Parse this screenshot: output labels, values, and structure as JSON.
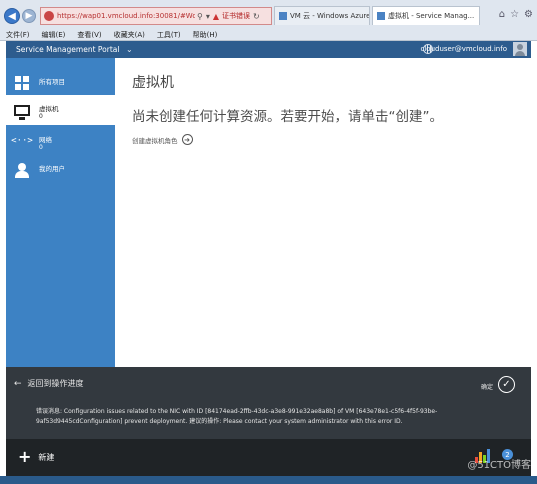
{
  "browser": {
    "url": "https://wap01.vmcloud.info:30081/#Workspace",
    "cert_error": "证书错误",
    "tabs": [
      {
        "label": "VM 云 - Windows Azure P...",
        "active": false
      },
      {
        "label": "虚拟机 - Service Manag...",
        "active": true
      }
    ],
    "menu": [
      "文件(F)",
      "编辑(E)",
      "查看(V)",
      "收藏夹(A)",
      "工具(T)",
      "帮助(H)"
    ]
  },
  "header": {
    "title": "Service Management Portal",
    "user": "clouduser@vmcloud.info"
  },
  "sidebar": {
    "items": [
      {
        "label": "所有项目",
        "count": "",
        "icon": "grid-icon"
      },
      {
        "label": "虚拟机",
        "count": "0",
        "icon": "monitor-icon",
        "selected": true
      },
      {
        "label": "网络",
        "count": "0",
        "icon": "network-icon"
      },
      {
        "label": "我的用户",
        "count": "",
        "icon": "user-icon"
      }
    ]
  },
  "main": {
    "title": "虚拟机",
    "empty_message": "尚未创建任何计算资源。若要开始，请单击“创建”。",
    "create_link": "创建虚拟机角色"
  },
  "notification": {
    "back_label": "返回到操作进度",
    "ok_label": "确定",
    "error_text": "错误消息: Configuration issues related to the NIC with ID [84174ead-2ffb-43dc-a3e8-991e32ae8a8b] of VM [643e78e1-c5f6-4f5f-93be-9af53d9445cdConfiguration] prevent deployment. 建议的操作: Please contact your system administrator with this error ID."
  },
  "bottom_bar": {
    "new_label": "新建",
    "badge_count": "2"
  },
  "watermark": "@51CTO博客",
  "colors": {
    "sidebar": "#3d82c4",
    "header": "#2d5c8e",
    "notify": "#33393f",
    "bottom": "#1f2326"
  }
}
